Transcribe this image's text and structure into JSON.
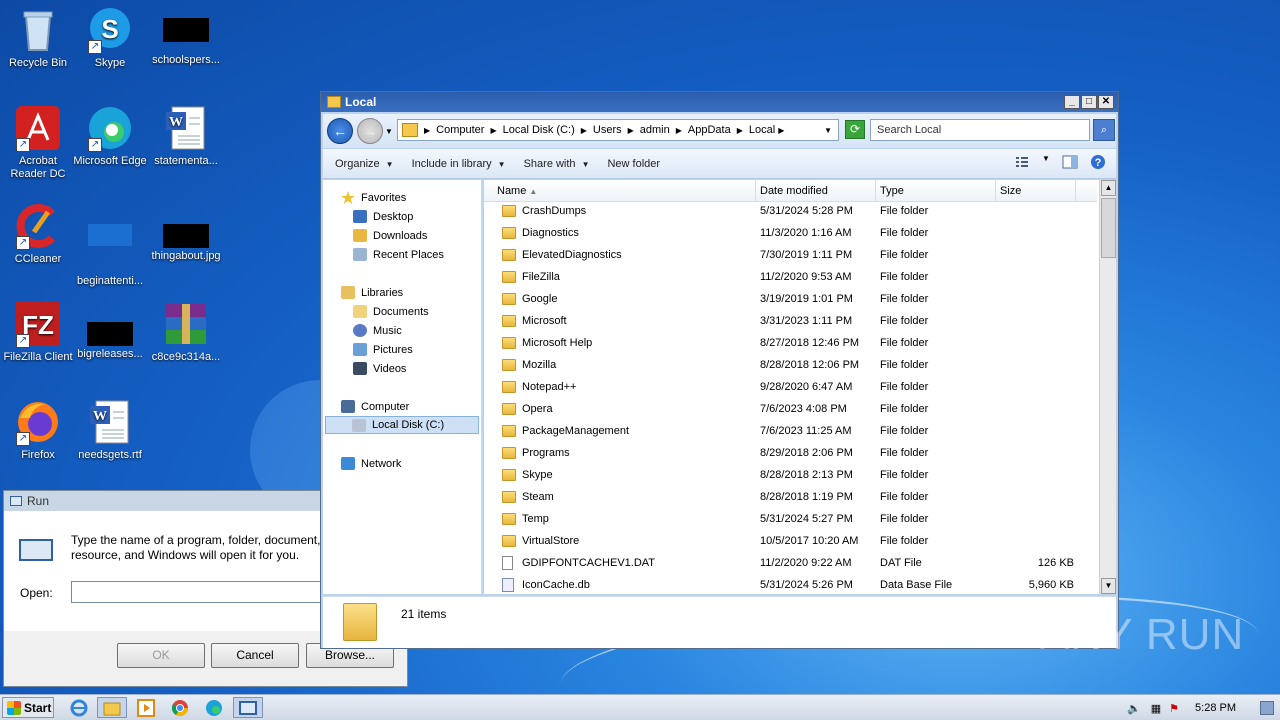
{
  "desktop": {
    "icons": [
      {
        "label": "Recycle Bin"
      },
      {
        "label": "Skype"
      },
      {
        "label": "schoolspers..."
      },
      {
        "label": "Acrobat Reader DC"
      },
      {
        "label": "Microsoft Edge"
      },
      {
        "label": "statementa..."
      },
      {
        "label": "CCleaner"
      },
      {
        "label": "beginattenti..."
      },
      {
        "label": "thingabout.jpg"
      },
      {
        "label": "FileZilla Client"
      },
      {
        "label": "bigreleases..."
      },
      {
        "label": "c8ce9c314a..."
      },
      {
        "label": "Firefox"
      },
      {
        "label": "needsgets.rtf"
      }
    ]
  },
  "explorer": {
    "title": "Local",
    "breadcrumb": [
      "Computer",
      "Local Disk (C:)",
      "Users",
      "admin",
      "AppData",
      "Local"
    ],
    "search_placeholder": "Search Local",
    "commands": {
      "organize": "Organize",
      "include": "Include in library",
      "share": "Share with",
      "newfolder": "New folder"
    },
    "nav": {
      "favorites": "Favorites",
      "desktop": "Desktop",
      "downloads": "Downloads",
      "recent": "Recent Places",
      "libraries": "Libraries",
      "documents": "Documents",
      "music": "Music",
      "pictures": "Pictures",
      "videos": "Videos",
      "computer": "Computer",
      "localdisk": "Local Disk (C:)",
      "network": "Network"
    },
    "columns": {
      "name": "Name",
      "date": "Date modified",
      "type": "Type",
      "size": "Size"
    },
    "files": [
      {
        "name": "CrashDumps",
        "date": "5/31/2024 5:28 PM",
        "type": "File folder",
        "size": "",
        "kind": "folder"
      },
      {
        "name": "Diagnostics",
        "date": "11/3/2020 1:16 AM",
        "type": "File folder",
        "size": "",
        "kind": "folder"
      },
      {
        "name": "ElevatedDiagnostics",
        "date": "7/30/2019 1:11 PM",
        "type": "File folder",
        "size": "",
        "kind": "folder"
      },
      {
        "name": "FileZilla",
        "date": "11/2/2020 9:53 AM",
        "type": "File folder",
        "size": "",
        "kind": "folder"
      },
      {
        "name": "Google",
        "date": "3/19/2019 1:01 PM",
        "type": "File folder",
        "size": "",
        "kind": "folder"
      },
      {
        "name": "Microsoft",
        "date": "3/31/2023 1:11 PM",
        "type": "File folder",
        "size": "",
        "kind": "folder"
      },
      {
        "name": "Microsoft Help",
        "date": "8/27/2018 12:46 PM",
        "type": "File folder",
        "size": "",
        "kind": "folder"
      },
      {
        "name": "Mozilla",
        "date": "8/28/2018 12:06 PM",
        "type": "File folder",
        "size": "",
        "kind": "folder"
      },
      {
        "name": "Notepad++",
        "date": "9/28/2020 6:47 AM",
        "type": "File folder",
        "size": "",
        "kind": "folder"
      },
      {
        "name": "Opera",
        "date": "7/6/2023 4:08 PM",
        "type": "File folder",
        "size": "",
        "kind": "folder"
      },
      {
        "name": "PackageManagement",
        "date": "7/6/2023 11:25 AM",
        "type": "File folder",
        "size": "",
        "kind": "folder"
      },
      {
        "name": "Programs",
        "date": "8/29/2018 2:06 PM",
        "type": "File folder",
        "size": "",
        "kind": "folder"
      },
      {
        "name": "Skype",
        "date": "8/28/2018 2:13 PM",
        "type": "File folder",
        "size": "",
        "kind": "folder"
      },
      {
        "name": "Steam",
        "date": "8/28/2018 1:19 PM",
        "type": "File folder",
        "size": "",
        "kind": "folder"
      },
      {
        "name": "Temp",
        "date": "5/31/2024 5:27 PM",
        "type": "File folder",
        "size": "",
        "kind": "folder"
      },
      {
        "name": "VirtualStore",
        "date": "10/5/2017 10:20 AM",
        "type": "File folder",
        "size": "",
        "kind": "folder"
      },
      {
        "name": "GDIPFONTCACHEV1.DAT",
        "date": "11/2/2020 9:22 AM",
        "type": "DAT File",
        "size": "126 KB",
        "kind": "file"
      },
      {
        "name": "IconCache.db",
        "date": "5/31/2024 5:26 PM",
        "type": "Data Base File",
        "size": "5,960 KB",
        "kind": "db"
      }
    ],
    "item_count": "21 items"
  },
  "run": {
    "title": "Run",
    "description": "Type the name of a program, folder, document, or Internet resource, and Windows will open it for you.",
    "open_label": "Open:",
    "open_value": "",
    "ok": "OK",
    "cancel": "Cancel",
    "browse": "Browse..."
  },
  "taskbar": {
    "start": "Start",
    "clock": "5:28 PM"
  },
  "watermark": "ANY RUN"
}
